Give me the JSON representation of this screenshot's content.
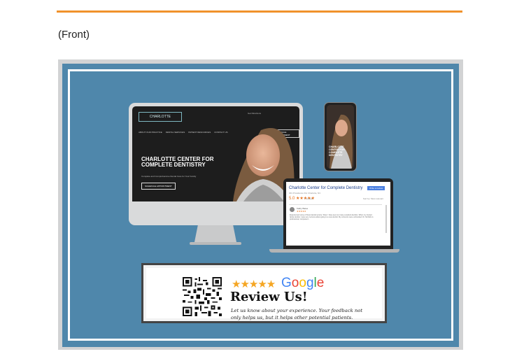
{
  "header": {
    "side_label": "(Front)"
  },
  "colors": {
    "accent_rule": "#f0922b",
    "card_blue": "#4f87ab",
    "star": "#f5a623"
  },
  "desktop_site": {
    "logo_text": "CHARLOTTE",
    "nav": [
      "ABOUT OUR PRACTICE",
      "DENTAL SERVICES",
      "PATIENT RESOURCES",
      "CONTACT US"
    ],
    "contact": "Get Directions",
    "appointment_button": "SCHEDULE APPOINTMENT",
    "hero_title": "CHARLOTTE CENTER FOR COMPLETE DENTISTRY",
    "hero_sub": "Complete and Comprehensive Dental Care for Your Family",
    "hero_button": "SCHEDULE APPOINTMENT"
  },
  "phone_site": {
    "hero_title": "CHARLOTTE CENTER FOR COMPLETE DENTISTRY"
  },
  "laptop_reviews": {
    "business_name": "Charlotte Center for Complete Dentistry",
    "address": "301 Providence Rd, Charlotte, NC",
    "write_button": "Write a review",
    "rating": "5.0 ★★★★★",
    "reviews_count": "7 reviews",
    "sort": "Sort by: Most relevant",
    "reviewer": "Kathy Bates",
    "review_stars": "★★★★★",
    "review_text": "Experienced some of finest dental service. Wow. I have seen so many excellent dentists. When my trusted family dentist, I was very nervous about going to a new dentist. My concerns were unfounded. Dr. Nicholls is professional, competent..."
  },
  "review_card": {
    "stars": "★★★★★",
    "brand_letters": [
      "G",
      "o",
      "o",
      "g",
      "l",
      "e"
    ],
    "title": "Review Us!",
    "text_line1": "Let us know about your experience.  Your feedback not",
    "text_line2": "only helps us, but it helps other potential patients."
  }
}
